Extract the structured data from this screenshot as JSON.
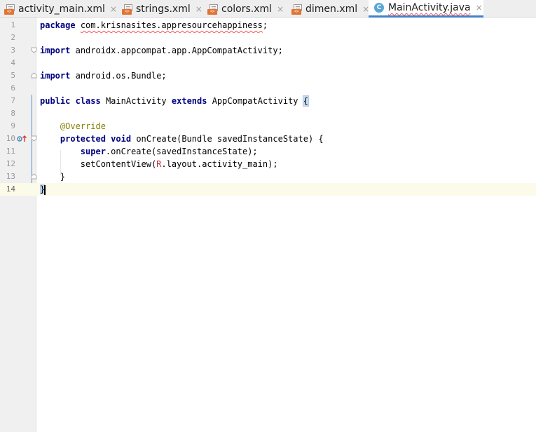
{
  "tabs": [
    {
      "label": "activity_main.xml",
      "icon": "xml-file-icon",
      "close": "×",
      "active": false
    },
    {
      "label": "strings.xml",
      "icon": "xml-file-icon",
      "close": "×",
      "active": false
    },
    {
      "label": "colors.xml",
      "icon": "xml-file-icon",
      "close": "×",
      "active": false
    },
    {
      "label": "dimen.xml",
      "icon": "xml-file-icon",
      "close": "×",
      "active": false
    },
    {
      "label": "MainActivity.java",
      "icon": "java-class-icon",
      "icon_letter": "C",
      "close": "×",
      "active": true
    }
  ],
  "editor": {
    "line_numbers": [
      "1",
      "2",
      "3",
      "4",
      "5",
      "6",
      "7",
      "8",
      "9",
      "10",
      "11",
      "12",
      "13",
      "14"
    ],
    "current_line": 14,
    "lines": {
      "l1": {
        "kw": "package",
        "pkg": "com.krisnasites.appresourcehappiness",
        "end": ";"
      },
      "l3": {
        "kw": "import",
        "rest": "androidx.appcompat.app.AppCompatActivity;"
      },
      "l5": {
        "kw": "import",
        "rest": "android.os.Bundle;"
      },
      "l7": {
        "kw1": "public",
        "kw2": "class",
        "name": "MainActivity",
        "kw3": "extends",
        "parent": "AppCompatActivity",
        "brace": "{"
      },
      "l9": {
        "annotation": "@Override"
      },
      "l10": {
        "kw1": "protected",
        "kw2": "void",
        "rest": "onCreate(Bundle savedInstanceState) {"
      },
      "l11": {
        "kw": "super",
        "rest": ".onCreate(savedInstanceState);"
      },
      "l12": {
        "pre": "setContentView(",
        "r": "R",
        "rest": ".layout.activity_main);"
      },
      "l13": {
        "text": "}"
      },
      "l14": {
        "text": "}"
      }
    },
    "colors": {
      "keyword": "#000080",
      "annotation": "#808000",
      "error_squiggle": "#ff4f4f",
      "current_line": "#fcfae8",
      "brace_match": "#c9dcf2"
    }
  }
}
